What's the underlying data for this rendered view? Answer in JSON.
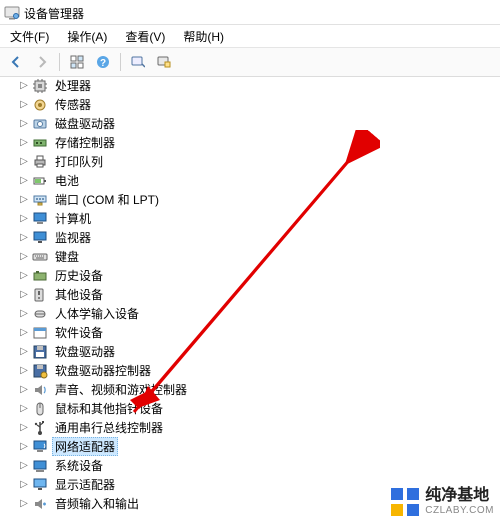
{
  "title": "设备管理器",
  "menus": {
    "file": "文件(F)",
    "action": "操作(A)",
    "view": "查看(V)",
    "help": "帮助(H)"
  },
  "tree": {
    "items": [
      {
        "label": "处理器",
        "iconKey": "cpu-icon",
        "selected": false
      },
      {
        "label": "传感器",
        "iconKey": "sensor-icon",
        "selected": false
      },
      {
        "label": "磁盘驱动器",
        "iconKey": "disk-icon",
        "selected": false
      },
      {
        "label": "存储控制器",
        "iconKey": "storage-ctrl-icon",
        "selected": false
      },
      {
        "label": "打印队列",
        "iconKey": "printer-icon",
        "selected": false
      },
      {
        "label": "电池",
        "iconKey": "battery-icon",
        "selected": false
      },
      {
        "label": "端口 (COM 和 LPT)",
        "iconKey": "port-icon",
        "selected": false
      },
      {
        "label": "计算机",
        "iconKey": "computer-icon",
        "selected": false
      },
      {
        "label": "监视器",
        "iconKey": "monitor-icon",
        "selected": false
      },
      {
        "label": "键盘",
        "iconKey": "keyboard-icon",
        "selected": false
      },
      {
        "label": "历史设备",
        "iconKey": "history-icon",
        "selected": false
      },
      {
        "label": "其他设备",
        "iconKey": "other-icon",
        "selected": false
      },
      {
        "label": "人体学输入设备",
        "iconKey": "hid-icon",
        "selected": false
      },
      {
        "label": "软件设备",
        "iconKey": "software-icon",
        "selected": false
      },
      {
        "label": "软盘驱动器",
        "iconKey": "floppy-icon",
        "selected": false
      },
      {
        "label": "软盘驱动器控制器",
        "iconKey": "floppy-ctrl-icon",
        "selected": false
      },
      {
        "label": "声音、视频和游戏控制器",
        "iconKey": "sound-icon",
        "selected": false
      },
      {
        "label": "鼠标和其他指针设备",
        "iconKey": "mouse-icon",
        "selected": false
      },
      {
        "label": "通用串行总线控制器",
        "iconKey": "usb-icon",
        "selected": false
      },
      {
        "label": "网络适配器",
        "iconKey": "network-icon",
        "selected": true
      },
      {
        "label": "系统设备",
        "iconKey": "system-icon",
        "selected": false
      },
      {
        "label": "显示适配器",
        "iconKey": "display-icon",
        "selected": false
      },
      {
        "label": "音频输入和输出",
        "iconKey": "audio-io-icon",
        "selected": false
      }
    ]
  },
  "watermark": {
    "text_top": "纯净基地",
    "text_bottom": "CZLABY.COM"
  }
}
